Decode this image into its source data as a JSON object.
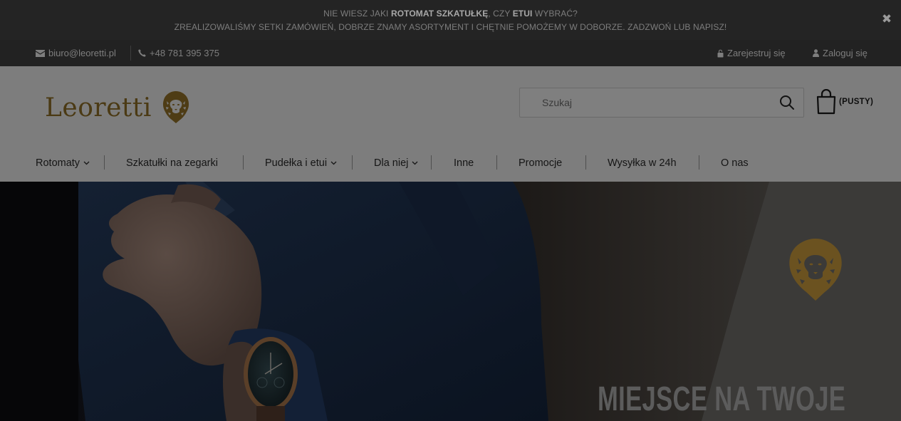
{
  "notice": {
    "line1_prefix": "NIE WIESZ JAKI ",
    "line1_bold1": "ROTOMAT SZKATUŁKĘ",
    "line1_mid": ", CZY ",
    "line1_bold2": "ETUI",
    "line1_suffix": " WYBRAĆ?",
    "line2": "ZREALIZOWALIŚMY SETKI ZAMÓWIEŃ, DOBRZE ZNAMY ASORTYMENT I CHĘTNIE POMOŻEMY W DOBORZE. ZADZWOŃ LUB NAPISZ!",
    "close_glyph": "✖"
  },
  "topbar": {
    "email": "biuro@leoretti.pl",
    "phone": "+48 781 395 375",
    "register": "Zarejestruj się",
    "login": "Zaloguj się"
  },
  "header": {
    "logo_text": "Leoretti",
    "search_placeholder": "Szukaj",
    "cart_label": "(PUSTY)"
  },
  "nav": [
    {
      "label": "Rotomaty",
      "has_dropdown": true
    },
    {
      "label": "Szkatułki na zegarki",
      "has_dropdown": false
    },
    {
      "label": "Pudełka i etui",
      "has_dropdown": true
    },
    {
      "label": "Dla niej",
      "has_dropdown": true
    },
    {
      "label": "Inne",
      "has_dropdown": false
    },
    {
      "label": "Promocje",
      "has_dropdown": false
    },
    {
      "label": "Wysyłka w 24h",
      "has_dropdown": false
    },
    {
      "label": "O nas",
      "has_dropdown": false
    }
  ],
  "hero": {
    "heading": "MIEJSCE NA TWOJE"
  },
  "colors": {
    "notice_bg": "#242424",
    "topbar_bg": "#222222",
    "header_bg_dimmed": "#7d7d7d",
    "logo_gold_dimmed": "#4b3a14",
    "hero_lion_gold": "#6b5220"
  },
  "icons": [
    "close-icon",
    "envelope-icon",
    "phone-icon",
    "lock-icon",
    "user-icon",
    "lion-logo-icon",
    "search-icon",
    "shopping-bag-icon",
    "chevron-down-icon"
  ]
}
